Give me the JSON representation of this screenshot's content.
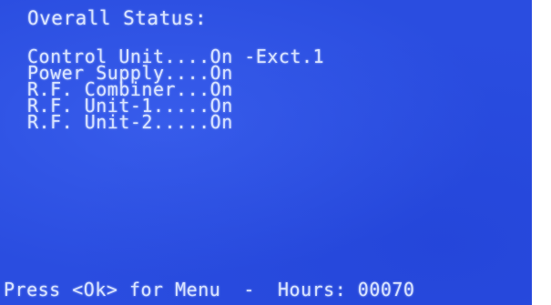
{
  "screen": {
    "title": "Overall Status:",
    "status_lines": [
      "Control Unit....On -Exct.1",
      "Power Supply....On",
      "R.F. Combiner...On",
      "R.F. Unit-1.....On",
      "R.F. Unit-2.....On"
    ],
    "footer": "Press <Ok> for Menu  -  Hours: 00070"
  },
  "colors": {
    "screen_background": "#2a4de0",
    "text": "#d9e4ff"
  }
}
